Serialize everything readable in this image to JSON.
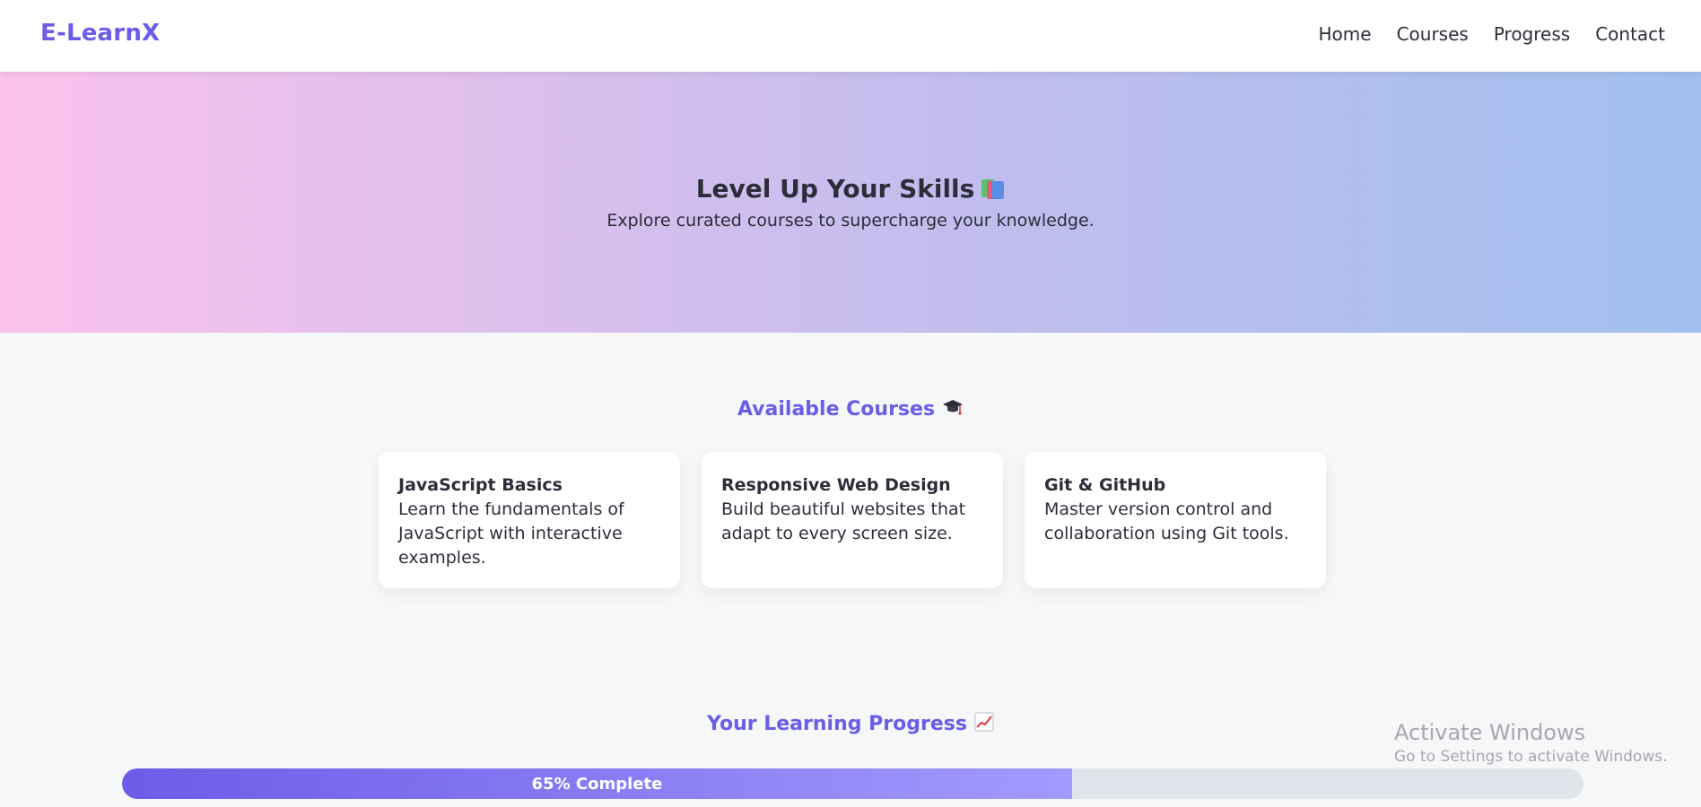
{
  "navbar": {
    "brand": "E-LearnX",
    "links": [
      {
        "label": "Home"
      },
      {
        "label": "Courses"
      },
      {
        "label": "Progress"
      },
      {
        "label": "Contact"
      }
    ]
  },
  "hero": {
    "title": "Level Up Your Skills",
    "title_icon": "books-icon",
    "subtitle": "Explore curated courses to supercharge your knowledge."
  },
  "courses": {
    "title": "Available Courses",
    "title_icon": "graduation-cap-icon",
    "items": [
      {
        "title": "JavaScript Basics",
        "description": "Learn the fundamentals of JavaScript with interactive examples."
      },
      {
        "title": "Responsive Web Design",
        "description": "Build beautiful websites that adapt to every screen size."
      },
      {
        "title": "Git & GitHub",
        "description": "Master version control and collaboration using Git tools."
      }
    ]
  },
  "progress": {
    "title": "Your Learning Progress",
    "title_icon": "chart-increasing-icon",
    "percent": 65,
    "label": "65% Complete"
  },
  "watermark": {
    "title": "Activate Windows",
    "subtitle": "Go to Settings to activate Windows."
  },
  "colors": {
    "accent": "#6c5ce7",
    "accent_light": "#a29bfe",
    "hero_start": "#fbc2eb",
    "hero_end": "#a1c0ef",
    "track": "#dfe5ea"
  }
}
